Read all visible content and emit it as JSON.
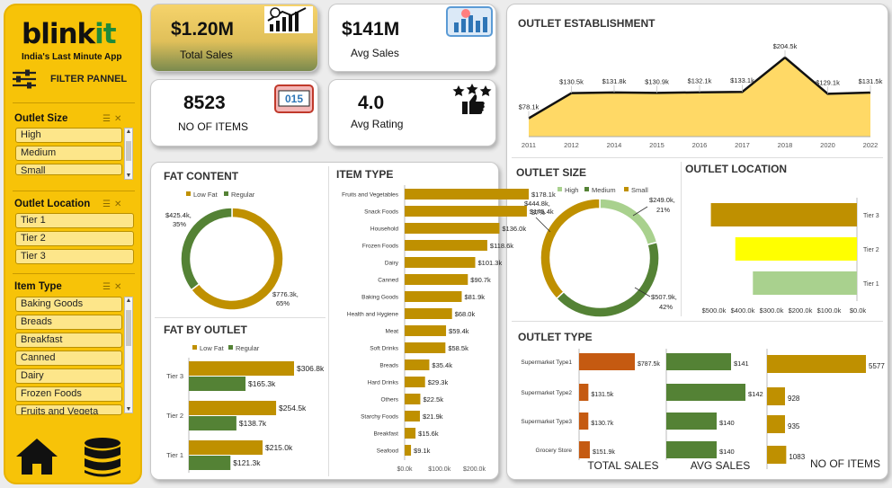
{
  "brand": {
    "logo_a": "blink",
    "logo_b": "it",
    "tagline": "India's Last Minute App",
    "filter_title": "FILTER PANNEL"
  },
  "slicers": [
    {
      "title": "Outlet Size",
      "items": [
        "High",
        "Medium",
        "Small"
      ]
    },
    {
      "title": "Outlet Location",
      "items": [
        "Tier 1",
        "Tier 2",
        "Tier 3"
      ]
    },
    {
      "title": "Item Type",
      "items": [
        "Baking Goods",
        "Breads",
        "Breakfast",
        "Canned",
        "Dairy",
        "Frozen Foods",
        "Fruits and Vegeta"
      ]
    }
  ],
  "kpis": [
    {
      "value": "$1.20M",
      "label": "Total Sales"
    },
    {
      "value": "$141M",
      "label": "Avg Sales"
    },
    {
      "value": "8523",
      "label": "NO OF ITEMS"
    },
    {
      "value": "4.0",
      "label": "Avg Rating"
    }
  ],
  "colors": {
    "gold": "#bf9000",
    "green": "#548235",
    "light_green": "#a9d18e",
    "yellow": "#ffff00",
    "orange": "#c55a11",
    "area": "#ffd966",
    "sidebar": "#f7c308"
  },
  "icons": [
    "filter-sliders-icon",
    "growth-chart-icon",
    "analytics-icon",
    "counter-icon",
    "rating-stars-icon",
    "home-icon",
    "database-icon"
  ],
  "chart_data": [
    {
      "id": "outlet_establishment",
      "type": "area",
      "title": "OUTLET ESTABLISHMENT",
      "x": [
        "2011",
        "2012",
        "2014",
        "2015",
        "2016",
        "2017",
        "2018",
        "2020",
        "2022"
      ],
      "values": [
        78.1,
        130.5,
        131.8,
        130.9,
        132.1,
        133.1,
        204.5,
        129.1,
        131.5
      ],
      "labels": [
        "$78.1k",
        "$130.5k",
        "$131.8k",
        "$130.9k",
        "$132.1k",
        "$133.1k",
        "$204.5k",
        "$129.1k",
        "$131.5k"
      ]
    },
    {
      "id": "fat_content",
      "type": "pie",
      "title": "FAT CONTENT",
      "series": [
        {
          "name": "Low Fat",
          "value": 776.3,
          "label": "$776.3k,",
          "pct": "65%"
        },
        {
          "name": "Regular",
          "value": 425.4,
          "label": "$425.4k,",
          "pct": "35%"
        }
      ]
    },
    {
      "id": "fat_by_outlet",
      "type": "bar",
      "title": "FAT BY OUTLET",
      "categories": [
        "Tier 3",
        "Tier 2",
        "Tier 1"
      ],
      "series": [
        {
          "name": "Low Fat",
          "values": [
            306.8,
            254.5,
            215.0
          ],
          "labels": [
            "$306.8k",
            "$254.5k",
            "$215.0k"
          ]
        },
        {
          "name": "Regular",
          "values": [
            165.3,
            138.7,
            121.3
          ],
          "labels": [
            "$165.3k",
            "$138.7k",
            "$121.3k"
          ]
        }
      ]
    },
    {
      "id": "item_type",
      "type": "bar",
      "title": "ITEM TYPE",
      "categories": [
        "Fruits and Vegetables",
        "Snack Foods",
        "Household",
        "Frozen Foods",
        "Dairy",
        "Canned",
        "Baking Goods",
        "Health and Hygiene",
        "Meat",
        "Soft Drinks",
        "Breads",
        "Hard Drinks",
        "Others",
        "Starchy Foods",
        "Breakfast",
        "Seafood"
      ],
      "values": [
        178.1,
        175.4,
        136.0,
        118.6,
        101.3,
        90.7,
        81.9,
        68.0,
        59.4,
        58.5,
        35.4,
        29.3,
        22.5,
        21.9,
        15.6,
        9.1
      ],
      "labels": [
        "$178.1k",
        "$175.4k",
        "$136.0k",
        "$118.6k",
        "$101.3k",
        "$90.7k",
        "$81.9k",
        "$68.0k",
        "$59.4k",
        "$58.5k",
        "$35.4k",
        "$29.3k",
        "$22.5k",
        "$21.9k",
        "$15.6k",
        "$9.1k"
      ],
      "xticks": [
        "$0.0k",
        "$100.0k",
        "$200.0k"
      ],
      "xlim": [
        0,
        200
      ]
    },
    {
      "id": "outlet_size",
      "type": "pie",
      "title": "OUTLET SIZE",
      "series": [
        {
          "name": "High",
          "value": 249.0,
          "label": "$249.0k,",
          "pct": "21%"
        },
        {
          "name": "Medium",
          "value": 507.9,
          "label": "$507.9k,",
          "pct": "42%"
        },
        {
          "name": "Small",
          "value": 444.8,
          "label": "$444.8k,",
          "pct": "37%"
        }
      ]
    },
    {
      "id": "outlet_location",
      "type": "bar",
      "title": "OUTLET LOCATION",
      "categories": [
        "Tier 3",
        "Tier 2",
        "Tier 1"
      ],
      "values": [
        472.1,
        393.2,
        336.4
      ],
      "xticks": [
        "$500.0k",
        "$400.0k",
        "$300.0k",
        "$200.0k",
        "$100.0k",
        "$0.0k"
      ],
      "xlim": [
        0,
        500
      ],
      "reversed": true
    },
    {
      "id": "outlet_type",
      "type": "bar",
      "title": "OUTLET TYPE",
      "categories": [
        "Supermarket Type1",
        "Supermarket Type2",
        "Supermarket Type3",
        "Grocery Store"
      ],
      "panels": [
        {
          "name": "TOTAL SALES",
          "values": [
            787.5,
            131.5,
            130.7,
            151.9
          ],
          "labels": [
            "$787.5k",
            "$131.5k",
            "$130.7k",
            "$151.9k"
          ]
        },
        {
          "name": "AVG SALES",
          "values": [
            141,
            142,
            140,
            140
          ],
          "labels": [
            "$141",
            "$142",
            "$140",
            "$140"
          ]
        },
        {
          "name": "NO OF ITEMS",
          "values": [
            5577,
            928,
            935,
            1083
          ],
          "labels": [
            "5577",
            "928",
            "935",
            "1083"
          ]
        }
      ]
    }
  ]
}
